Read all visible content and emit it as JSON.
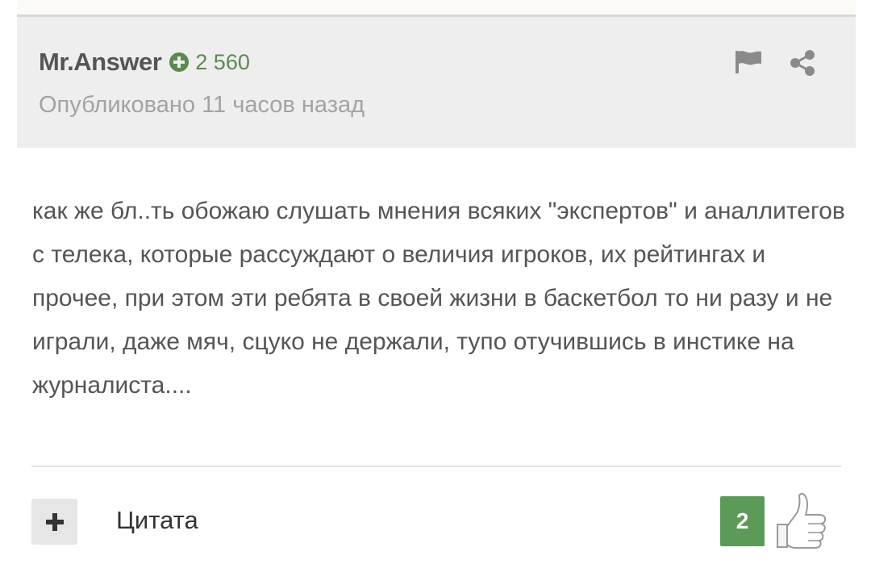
{
  "comment": {
    "author": "Mr.Answer",
    "rating": "2 560",
    "published": "Опубликовано 11 часов назад",
    "body": "как же бл..ть обожаю слушать мнения всяких \"экспертов\" и аналлитегов с телека, которые рассуждают о величия игроков, их рейтингах и прочее, при этом эти ребята в своей жизни в баскетбол то ни разу и не играли, даже мяч, сцуко не держали, тупо отучившись в инстике на журналиста....",
    "actions": {
      "quote_label": "Цитата",
      "likes": "2"
    }
  },
  "icons": {
    "rating": "plus-circle-icon",
    "flag": "flag-icon",
    "share": "share-icon",
    "plus": "plus-icon",
    "like": "thumbs-up-icon"
  },
  "colors": {
    "rating_green": "#5c8a4e",
    "likes_badge": "#5c9a57",
    "header_bg": "#eeeeee"
  }
}
